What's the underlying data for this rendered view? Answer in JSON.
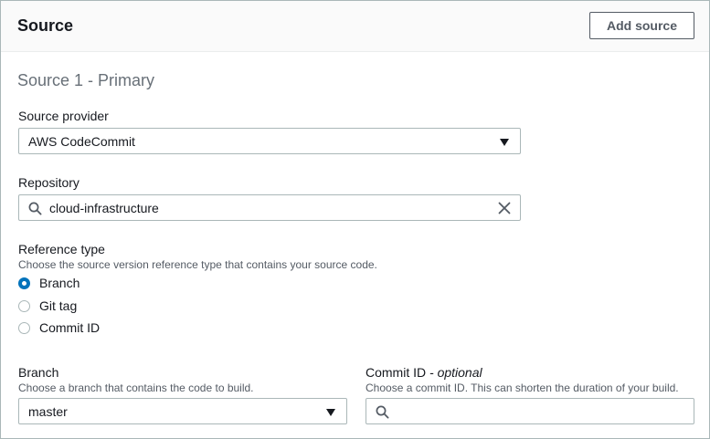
{
  "header": {
    "title": "Source",
    "add_source_label": "Add source"
  },
  "source": {
    "section_title": "Source 1 - Primary",
    "provider": {
      "label": "Source provider",
      "value": "AWS CodeCommit"
    },
    "repository": {
      "label": "Repository",
      "value": "cloud-infrastructure"
    },
    "reference_type": {
      "label": "Reference type",
      "description": "Choose the source version reference type that contains your source code.",
      "options": [
        "Branch",
        "Git tag",
        "Commit ID"
      ],
      "selected": "Branch"
    },
    "branch": {
      "label": "Branch",
      "description": "Choose a branch that contains the code to build.",
      "value": "master"
    },
    "commit_id": {
      "label": "Commit ID",
      "label_suffix": "- optional",
      "description": "Choose a commit ID. This can shorten the duration of your build.",
      "value": ""
    }
  },
  "colors": {
    "accent": "#0073bb",
    "border": "#aab7b8",
    "text": "#16191f",
    "muted": "#687078"
  },
  "icons": {
    "dropdown": "caret-down-icon",
    "search": "search-icon",
    "clear": "close-icon"
  }
}
